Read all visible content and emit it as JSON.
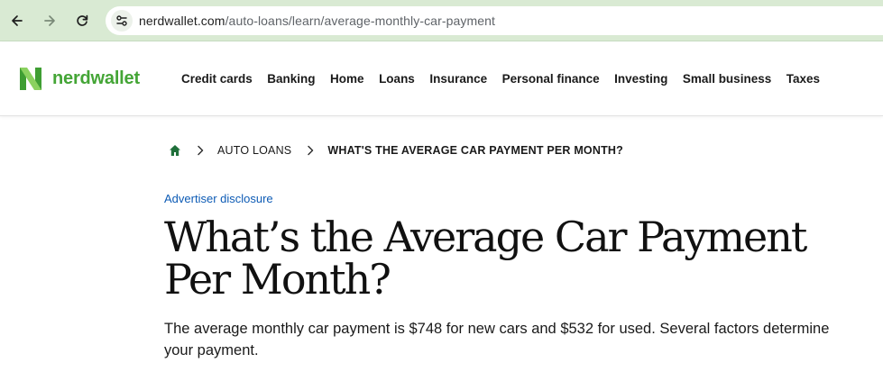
{
  "browser": {
    "url_host": "nerdwallet.com",
    "url_path": "/auto-loans/learn/average-monthly-car-payment"
  },
  "header": {
    "logo_text": "nerdwallet",
    "nav": [
      "Credit cards",
      "Banking",
      "Home",
      "Loans",
      "Insurance",
      "Personal finance",
      "Investing",
      "Small business",
      "Taxes"
    ]
  },
  "breadcrumb": {
    "items": [
      "AUTO LOANS",
      "WHAT'S THE AVERAGE CAR PAYMENT PER MONTH?"
    ]
  },
  "article": {
    "advertiser_disclosure": "Advertiser disclosure",
    "title": "What’s the Average Car Payment Per Month?",
    "summary": "The average monthly car payment is $748 for new cars and $532 for used. Several factors determine your payment."
  },
  "colors": {
    "brand_green": "#44a536",
    "link_blue": "#0d5bb5",
    "chrome_green": "#d9ead3"
  }
}
